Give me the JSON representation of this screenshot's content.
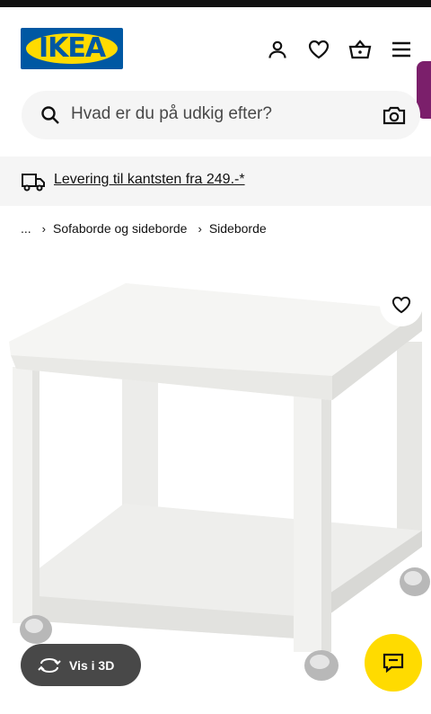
{
  "brand": {
    "logo_text": "IKEA",
    "primary_color": "#0058a3",
    "accent_color": "#ffdb00"
  },
  "header": {
    "icons": [
      "person-icon",
      "heart-icon",
      "basket-icon",
      "menu-icon"
    ]
  },
  "search": {
    "placeholder": "Hvad er du på udkig efter?"
  },
  "delivery": {
    "text": "Levering til kantsten fra 249.-*"
  },
  "breadcrumb": {
    "items": [
      "...",
      "Sofaborde og sideborde",
      "Sideborde"
    ]
  },
  "product": {
    "vis3d_label": "Vis i 3D"
  }
}
